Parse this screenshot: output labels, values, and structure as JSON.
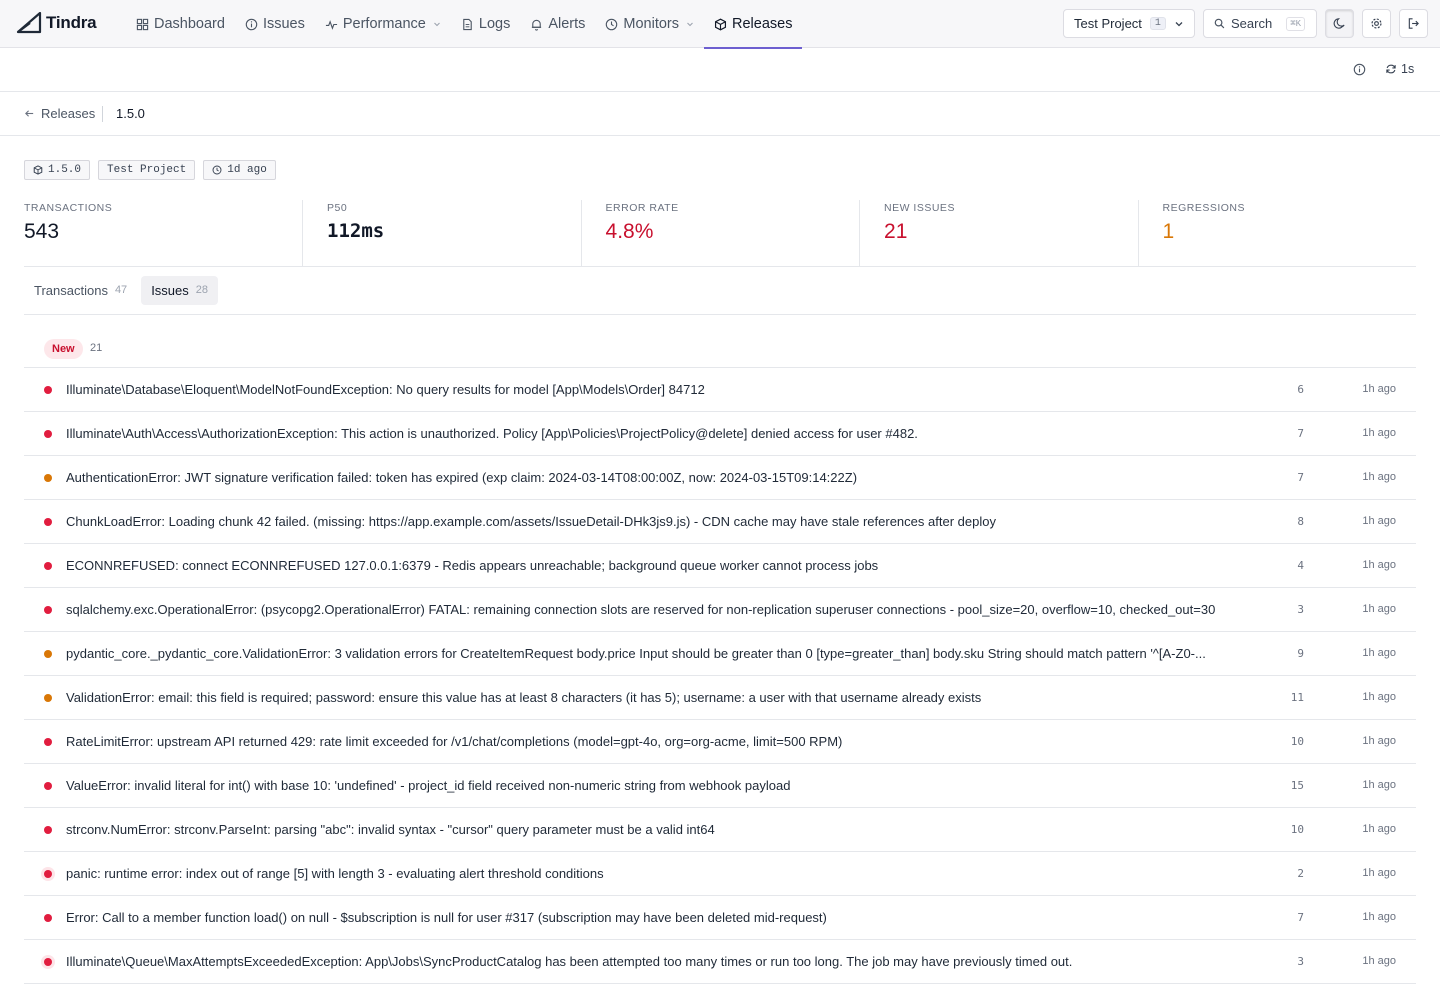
{
  "app": {
    "name": "Tindra",
    "logo_icon": "tindra-logo-icon",
    "accent_color": "#6d5fd0"
  },
  "nav": {
    "items": [
      {
        "label": "Dashboard",
        "icon": "grid-icon"
      },
      {
        "label": "Issues",
        "icon": "info-circle-icon"
      },
      {
        "label": "Performance",
        "icon": "pulse-icon",
        "dropdown": true
      },
      {
        "label": "Logs",
        "icon": "file-icon"
      },
      {
        "label": "Alerts",
        "icon": "bell-icon"
      },
      {
        "label": "Monitors",
        "icon": "clock-icon",
        "dropdown": true
      },
      {
        "label": "Releases",
        "icon": "package-icon",
        "active": true
      }
    ],
    "project_selector": {
      "label": "Test Project",
      "count": "1"
    },
    "search": {
      "label": "Search",
      "shortcut": "⌘K"
    }
  },
  "toolbar": {
    "refresh_label": "1s"
  },
  "breadcrumb": {
    "back_label": "Releases",
    "current": "1.5.0"
  },
  "release": {
    "tags": [
      {
        "label": "1.5.0",
        "icon": "package-icon"
      },
      {
        "label": "Test Project",
        "icon": ""
      },
      {
        "label": "1d ago",
        "icon": "clock-icon"
      }
    ],
    "stats": [
      {
        "label": "TRANSACTIONS",
        "value": "543"
      },
      {
        "label": "P50",
        "value": "112ms"
      },
      {
        "label": "ERROR RATE",
        "value": "4.8%"
      },
      {
        "label": "NEW ISSUES",
        "value": "21"
      },
      {
        "label": "REGRESSIONS",
        "value": "1"
      }
    ],
    "status_colors": {
      "error": "#c8102e",
      "warning": "#d97706"
    }
  },
  "tabs": [
    {
      "label": "Transactions",
      "count": "47",
      "active": false
    },
    {
      "label": "Issues",
      "count": "28",
      "active": true
    }
  ],
  "issues": {
    "group_label": "New",
    "group_count": "21",
    "rows": [
      {
        "level": "error",
        "title": "Illuminate\\Database\\Eloquent\\ModelNotFoundException: No query results for model [App\\Models\\Order] 84712",
        "count": "6",
        "time": "1h ago"
      },
      {
        "level": "error",
        "title": "Illuminate\\Auth\\Access\\AuthorizationException: This action is unauthorized. Policy [App\\Policies\\ProjectPolicy@delete] denied access for user #482.",
        "count": "7",
        "time": "1h ago"
      },
      {
        "level": "warning",
        "title": "AuthenticationError: JWT signature verification failed: token has expired (exp claim: 2024-03-14T08:00:00Z, now: 2024-03-15T09:14:22Z)",
        "count": "7",
        "time": "1h ago"
      },
      {
        "level": "error",
        "title": "ChunkLoadError: Loading chunk 42 failed. (missing: https://app.example.com/assets/IssueDetail-DHk3js9.js) - CDN cache may have stale references after deploy",
        "count": "8",
        "time": "1h ago"
      },
      {
        "level": "error",
        "title": "ECONNREFUSED: connect ECONNREFUSED 127.0.0.1:6379 - Redis appears unreachable; background queue worker cannot process jobs",
        "count": "4",
        "time": "1h ago"
      },
      {
        "level": "error",
        "title": "sqlalchemy.exc.OperationalError: (psycopg2.OperationalError) FATAL: remaining connection slots are reserved for non-replication superuser connections - pool_size=20, overflow=10, checked_out=30",
        "count": "3",
        "time": "1h ago"
      },
      {
        "level": "warning",
        "title": "pydantic_core._pydantic_core.ValidationError: 3 validation errors for CreateItemRequest body.price Input should be greater than 0 [type=greater_than] body.sku String should match pattern '^[A-Z0-...",
        "count": "9",
        "time": "1h ago"
      },
      {
        "level": "warning",
        "title": "ValidationError: email: this field is required; password: ensure this value has at least 8 characters (it has 5); username: a user with that username already exists",
        "count": "11",
        "time": "1h ago"
      },
      {
        "level": "error",
        "title": "RateLimitError: upstream API returned 429: rate limit exceeded for /v1/chat/completions (model=gpt-4o, org=org-acme, limit=500 RPM)",
        "count": "10",
        "time": "1h ago"
      },
      {
        "level": "error",
        "title": "ValueError: invalid literal for int() with base 10: 'undefined' - project_id field received non-numeric string from webhook payload",
        "count": "15",
        "time": "1h ago"
      },
      {
        "level": "error",
        "title": "strconv.NumError: strconv.ParseInt: parsing \"abc\": invalid syntax - \"cursor\" query parameter must be a valid int64",
        "count": "10",
        "time": "1h ago"
      },
      {
        "level": "error",
        "glow": true,
        "title": "panic: runtime error: index out of range [5] with length 3 - evaluating alert threshold conditions",
        "count": "2",
        "time": "1h ago"
      },
      {
        "level": "error",
        "title": "Error: Call to a member function load() on null - $subscription is null for user #317 (subscription may have been deleted mid-request)",
        "count": "7",
        "time": "1h ago"
      },
      {
        "level": "error",
        "glow": true,
        "title": "Illuminate\\Queue\\MaxAttemptsExceededException: App\\Jobs\\SyncProductCatalog has been attempted too many times or run too long. The job may have previously timed out.",
        "count": "3",
        "time": "1h ago"
      }
    ]
  }
}
